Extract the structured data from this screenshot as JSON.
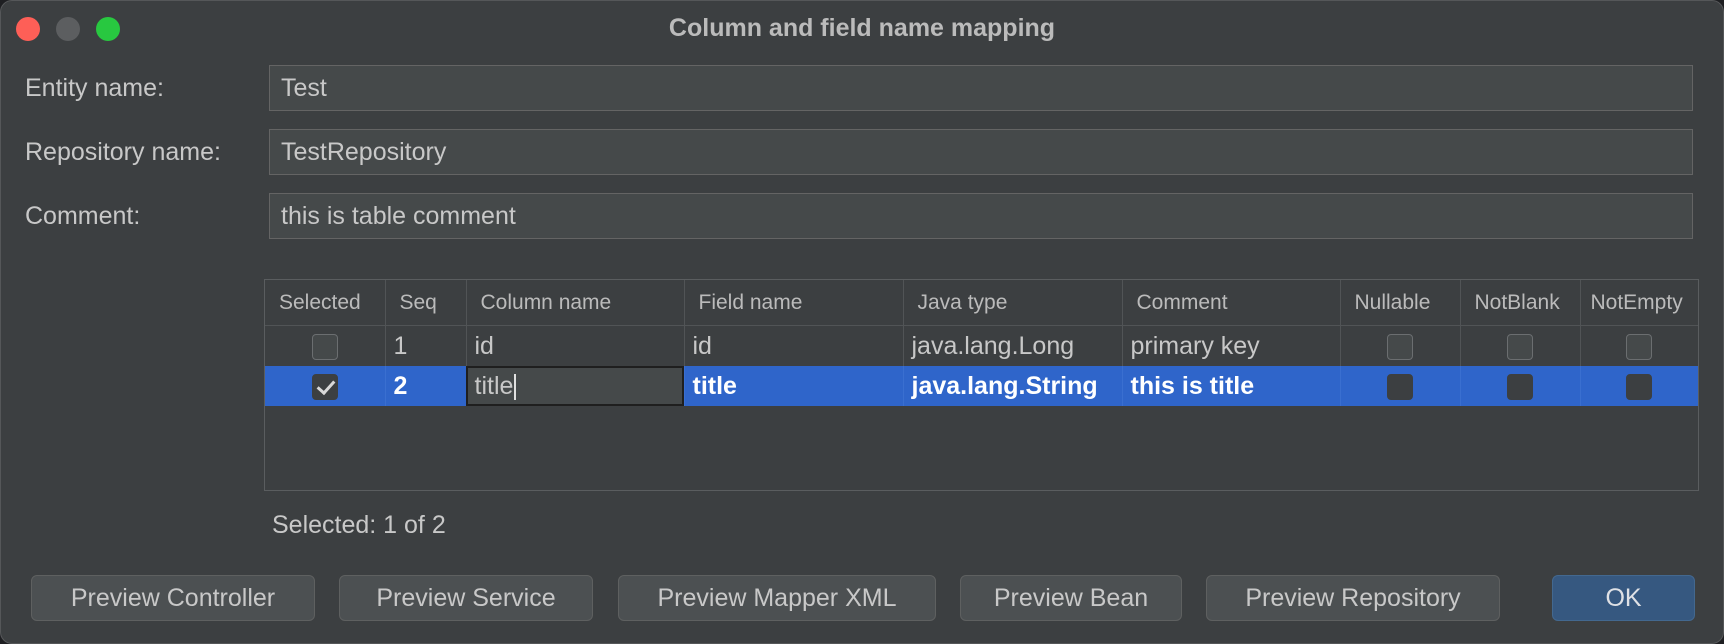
{
  "window": {
    "title": "Column and field name mapping"
  },
  "form": {
    "entity_label": "Entity name:",
    "entity_value": "Test",
    "repo_label": "Repository name:",
    "repo_value": "TestRepository",
    "comment_label": "Comment:",
    "comment_value": "this is table comment"
  },
  "table": {
    "headers": [
      "Selected",
      "Seq",
      "Column name",
      "Field name",
      "Java type",
      "Comment",
      "Nullable",
      "NotBlank",
      "NotEmpty"
    ],
    "rows": [
      {
        "selected": false,
        "seq": "1",
        "column": "id",
        "field": "id",
        "type": "java.lang.Long",
        "comment": "primary key",
        "nullable": false,
        "notblank": false,
        "notempty": false
      },
      {
        "selected": true,
        "seq": "2",
        "column": "title",
        "field": "title",
        "type": "java.lang.String",
        "comment": "this is title",
        "nullable": false,
        "notblank": false,
        "notempty": false
      }
    ]
  },
  "status": "Selected: 1 of 2",
  "buttons": {
    "preview_controller": "Preview Controller",
    "preview_service": "Preview Service",
    "preview_mapper": "Preview Mapper XML",
    "preview_bean": "Preview Bean",
    "preview_repository": "Preview Repository",
    "ok": "OK"
  },
  "colors": {
    "accent": "#2f65ca",
    "ok_button": "#365880",
    "background": "#3c3f41"
  }
}
